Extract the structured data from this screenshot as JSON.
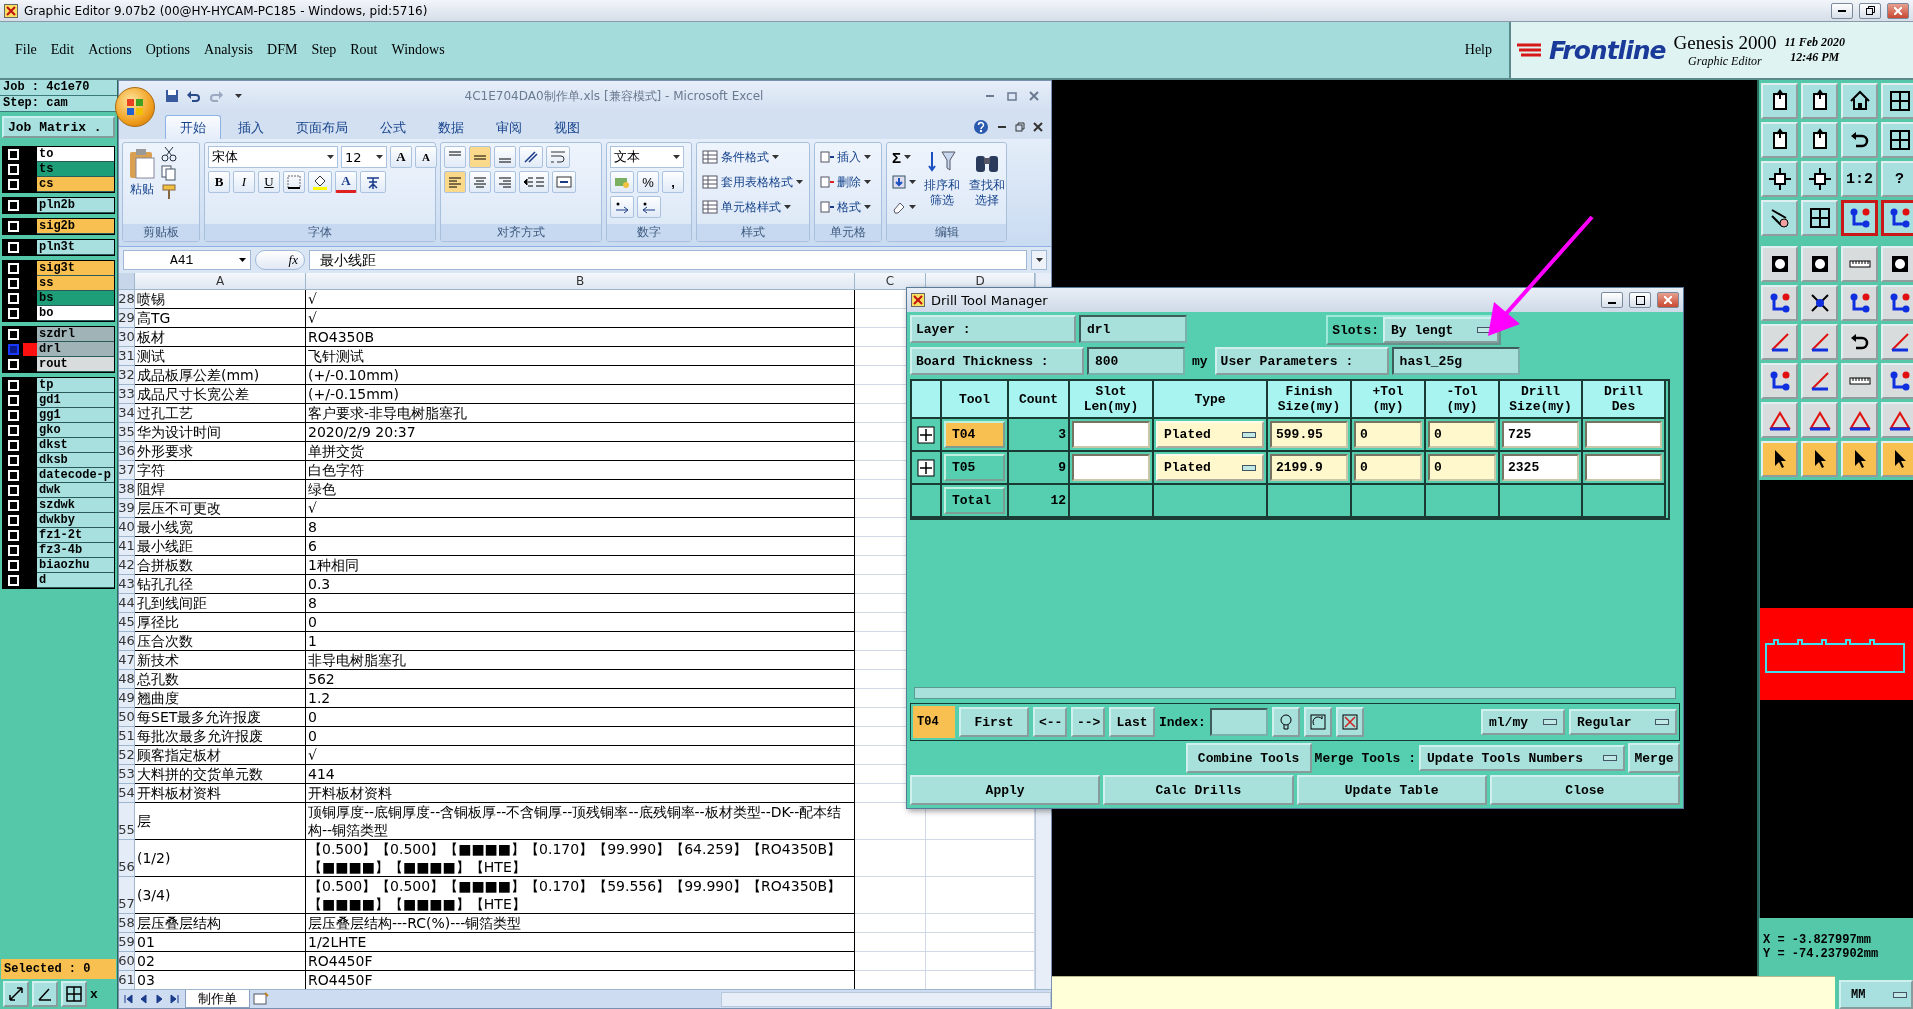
{
  "window": {
    "title": "Graphic Editor 9.07b2 (00@HY-HYCAM-PC185 - Windows, pid:5716)"
  },
  "menu": [
    "File",
    "Edit",
    "Actions",
    "Options",
    "Analysis",
    "DFM",
    "Step",
    "Rout",
    "Windows"
  ],
  "help": "Help",
  "brand": {
    "logo": "Frontline",
    "product": "Genesis 2000",
    "subtitle": "Graphic Editor",
    "date": "11 Feb 2020",
    "time": "12:46 PM"
  },
  "job_panel": {
    "job": "Job : 4c1e70",
    "step": "Step: cam",
    "matrix_button": "Job Matrix .",
    "groups": [
      {
        "layers": [
          {
            "name": "to",
            "color": "#ffffff",
            "selected": false
          },
          {
            "name": "ts",
            "color": "#1e9e78",
            "selected": false
          },
          {
            "name": "cs",
            "color": "#f8c050",
            "selected": false
          }
        ]
      },
      {
        "layers": [
          {
            "name": "pln2b",
            "color": "#a8e0e0",
            "selected": false
          }
        ]
      },
      {
        "layers": [
          {
            "name": "sig2b",
            "color": "#f8c050",
            "selected": false
          }
        ]
      },
      {
        "layers": [
          {
            "name": "pln3t",
            "color": "#a8e0e0",
            "selected": false
          }
        ]
      },
      {
        "layers": [
          {
            "name": "sig3t",
            "color": "#f8c050",
            "selected": false
          },
          {
            "name": "ss",
            "color": "#f8c050",
            "selected": false
          },
          {
            "name": "bs",
            "color": "#1e9e78",
            "selected": false
          },
          {
            "name": "bo",
            "color": "#ffffff",
            "selected": false
          }
        ]
      },
      {
        "layers": [
          {
            "name": "szdrl",
            "color": "#a0b4b8",
            "selected": false
          },
          {
            "name": "drl",
            "color": "#a0b4b8",
            "selected": true
          },
          {
            "name": "rout",
            "color": "#d8dcdc",
            "selected": false
          }
        ]
      },
      {
        "layers": [
          {
            "name": "tp",
            "color": "#a8e0e0",
            "selected": false
          },
          {
            "name": "gd1",
            "color": "#a8e0e0",
            "selected": false
          },
          {
            "name": "gg1",
            "color": "#a8e0e0",
            "selected": false
          },
          {
            "name": "gko",
            "color": "#a8e0e0",
            "selected": false
          },
          {
            "name": "dkst",
            "color": "#a8e0e0",
            "selected": false
          },
          {
            "name": "dksb",
            "color": "#a8e0e0",
            "selected": false
          },
          {
            "name": "datecode-p",
            "color": "#a8e0e0",
            "selected": false
          },
          {
            "name": "dwk",
            "color": "#a8e0e0",
            "selected": false
          },
          {
            "name": "szdwk",
            "color": "#a8e0e0",
            "selected": false
          },
          {
            "name": "dwkby",
            "color": "#a8e0e0",
            "selected": false
          },
          {
            "name": "fz1-2t",
            "color": "#a8e0e0",
            "selected": false
          },
          {
            "name": "fz3-4b",
            "color": "#a8e0e0",
            "selected": false
          },
          {
            "name": "biaozhu",
            "color": "#a8e0e0",
            "selected": false
          },
          {
            "name": "d",
            "color": "#a8e0e0",
            "selected": false
          }
        ]
      }
    ],
    "selected_count": "Selected : 0",
    "coord_label": "x"
  },
  "excel": {
    "title": "4C1E704DA0制作单.xls  [兼容模式] - Microsoft Excel",
    "tabs": [
      {
        "label": "开始",
        "selected": true
      },
      {
        "label": "插入",
        "selected": false
      },
      {
        "label": "页面布局",
        "selected": false
      },
      {
        "label": "公式",
        "selected": false
      },
      {
        "label": "数据",
        "selected": false
      },
      {
        "label": "审阅",
        "selected": false
      },
      {
        "label": "视图",
        "selected": false
      }
    ],
    "ribbon": {
      "clipboard": {
        "paste": "粘贴",
        "label": "剪贴板"
      },
      "font": {
        "name": "宋体",
        "size": "12",
        "grow": "A",
        "shrink": "A",
        "bold": "B",
        "italic": "I",
        "underline": "U",
        "color_key": "A",
        "label": "字体"
      },
      "alignment": {
        "label": "对齐方式"
      },
      "number": {
        "format": "文本",
        "percent": "%",
        "comma": ",",
        "label": "数字"
      },
      "styles": {
        "items": [
          "条件格式",
          "套用表格格式",
          "单元格样式"
        ],
        "label": "样式"
      },
      "cells": {
        "items": [
          "插入",
          "删除",
          "格式"
        ],
        "label": "单元格"
      },
      "editing": {
        "sum": "Σ",
        "sort": "排序和筛选",
        "find": "查找和选择",
        "label": "编辑"
      }
    },
    "name_box": "A41",
    "fx": "fx",
    "formula": "最小线距",
    "columns": [
      "A",
      "B",
      "C",
      "D"
    ],
    "rows": [
      {
        "n": "28",
        "a": "喷锡",
        "b": "√"
      },
      {
        "n": "29",
        "a": "高TG",
        "b": "√"
      },
      {
        "n": "30",
        "a": "板材",
        "b": "RO4350B"
      },
      {
        "n": "31",
        "a": "测试",
        "b": "飞针测试"
      },
      {
        "n": "32",
        "a": "成品板厚公差(mm)",
        "b": "(+/-0.10mm)"
      },
      {
        "n": "33",
        "a": "成品尺寸长宽公差",
        "b": "(+/-0.15mm)"
      },
      {
        "n": "34",
        "a": "过孔工艺",
        "b": "客户要求-非导电树脂塞孔"
      },
      {
        "n": "35",
        "a": "华为设计时间",
        "b": "2020/2/9 20:37"
      },
      {
        "n": "36",
        "a": "外形要求",
        "b": "单拼交货"
      },
      {
        "n": "37",
        "a": "字符",
        "b": "白色字符"
      },
      {
        "n": "38",
        "a": "阻焊",
        "b": "绿色"
      },
      {
        "n": "39",
        "a": "层压不可更改",
        "b": "√"
      },
      {
        "n": "40",
        "a": "最小线宽",
        "b": "8"
      },
      {
        "n": "41",
        "a": "最小线距",
        "b": "6"
      },
      {
        "n": "42",
        "a": "合拼板数",
        "b": "1种相同"
      },
      {
        "n": "43",
        "a": "钻孔孔径",
        "b": "0.3"
      },
      {
        "n": "44",
        "a": "孔到线间距",
        "b": "8"
      },
      {
        "n": "45",
        "a": "厚径比",
        "b": "0"
      },
      {
        "n": "46",
        "a": "压合次数",
        "b": "1"
      },
      {
        "n": "47",
        "a": "新技术",
        "b": "非导电树脂塞孔"
      },
      {
        "n": "48",
        "a": "总孔数",
        "b": "562"
      },
      {
        "n": "49",
        "a": "翘曲度",
        "b": "1.2"
      },
      {
        "n": "50",
        "a": "每SET最多允许报废",
        "b": "0"
      },
      {
        "n": "51",
        "a": "每批次最多允许报废",
        "b": "0"
      },
      {
        "n": "52",
        "a": "顾客指定板材",
        "b": "√"
      },
      {
        "n": "53",
        "a": "大料拼的交货单元数",
        "b": "414"
      },
      {
        "n": "54",
        "a": "开料板材资料",
        "b": "开料板材资料"
      },
      {
        "n": "55",
        "a": "层",
        "b": "顶铜厚度--底铜厚度--含铜板厚--不含铜厚--顶残铜率--底残铜率--板材类型--DK--配本结构--铜箔类型"
      },
      {
        "n": "56",
        "a": "(1/2)",
        "b": "【0.500】【0.500】【■■■■】【0.170】【99.990】【64.259】【RO4350B】【■■■■】【■■■■】【HTE】"
      },
      {
        "n": "57",
        "a": "(3/4)",
        "b": "【0.500】【0.500】【■■■■】【0.170】【59.556】【99.990】【RO4350B】【■■■■】【■■■■】【HTE】"
      },
      {
        "n": "58",
        "a": "层压叠层结构",
        "b": "层压叠层结构---RC(%)---铜箔类型"
      },
      {
        "n": "59",
        "a": "01",
        "b": "1/2LHTE"
      },
      {
        "n": "60",
        "a": "02",
        "b": "RO4450F"
      },
      {
        "n": "61",
        "a": "03",
        "b": "RO4450F"
      }
    ],
    "sheet_tab": "制作单"
  },
  "drill": {
    "title": "Drill Tool Manager",
    "layer_label": "Layer :",
    "layer": "drl",
    "slots_label": "Slots:",
    "slots": "By lengt",
    "thickness_label": "Board Thickness :",
    "thickness": "800",
    "unit": "my",
    "params_label": "User Parameters :",
    "params": "hasl_25g",
    "columns": [
      "Tool",
      "Count",
      "Slot\nLen(my)",
      "Type",
      "Finish\nSize(my)",
      "+Tol\n(my)",
      "-Tol\n(my)",
      "Drill\nSize(my)",
      "Drill\nDes"
    ],
    "tools": [
      {
        "tool": "T04",
        "selected": true,
        "count": "3",
        "type": "Plated",
        "finish": "599.95",
        "plus_tol": "0",
        "minus_tol": "0",
        "drill": "725"
      },
      {
        "tool": "T05",
        "selected": false,
        "count": "9",
        "type": "Plated",
        "finish": "2199.9",
        "plus_tol": "0",
        "minus_tol": "0",
        "drill": "2325"
      }
    ],
    "total_label": "Total",
    "total": "12",
    "nav": {
      "current": "T04",
      "first": "First",
      "prev": "<--",
      "next": "-->",
      "last": "Last",
      "index_label": "Index:",
      "units": "ml/my",
      "mode": "Regular"
    },
    "combine": "Combine Tools",
    "merge_label": "Merge Tools :",
    "merge_mode": "Update Tools Numbers",
    "merge": "Merge",
    "buttons": [
      "Apply",
      "Calc Drills",
      "Update Table",
      "Close"
    ]
  },
  "tool_keys": [
    "1:2",
    "?"
  ],
  "coords": {
    "x": "X = -3.827997mm",
    "y": "Y = -74.237902mm"
  },
  "units": "MM"
}
